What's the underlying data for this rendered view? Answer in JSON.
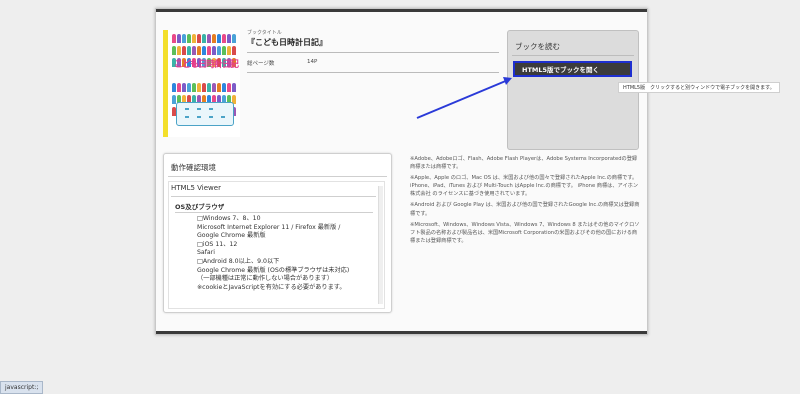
{
  "book": {
    "cover_title": "こども日時計日記",
    "title_label": "ブックタイトル",
    "title": "『こども日時計日記』",
    "pages_label": "総ページ数",
    "pages_value": "14P"
  },
  "read": {
    "title": "ブックを読む",
    "html5_button": "HTML5版でブックを開く",
    "tooltip": "HTML5版　クリックすると別ウィンドウで電子ブックを開きます。"
  },
  "env": {
    "title": "動作確認環境",
    "viewer_title": "HTML5 Viewer",
    "os_title": "OS及びブラウザ",
    "os_lines": [
      "□Windows 7、8、10",
      "Microsoft Internet Explorer 11 / Firefox 最新版 /",
      "Google Chrome 最新版",
      "□iOS 11、12",
      "Safari",
      "□Android 8.0以上、9.0以下",
      "Google Chrome 最新版 (OSの標準ブラウザは未対応)",
      "（一部機種は正常に動作しない場合があります）",
      "※cookieとJavaScriptを有効にする必要があります。"
    ]
  },
  "notes": [
    "※Adobe、Adobeロゴ、Flash、Adobe Flash Playerは、Adobe Systems Incorporatedの登録商標または商標です。",
    "※Apple、Apple のロゴ、Mac OS は、米国および他の国々で登録されたApple Inc.の商標です。\niPhone、iPad、iTunes および Multi-Touch はApple Inc.の商標です。 iPhone 商標は、アイホン株式会社 のライセンスに基づき使用されています。",
    "※Android および Google Play は、米国および他の国で登録されたGoogle Inc.の商標又は登録商標です。",
    "※Microsoft、Windows、Windows Vista、Windows 7、Windows 8 またはその他のマイクロソフト製品の名称および製品名は、米国Microsoft Corporationの米国およびその他の国における商標または登録商標です。"
  ],
  "status_bar": "javascript:;",
  "colors": {
    "arrow": "#2a3ad8",
    "cover_spine": "#f3df2b",
    "button_border": "#1e2fd0"
  }
}
